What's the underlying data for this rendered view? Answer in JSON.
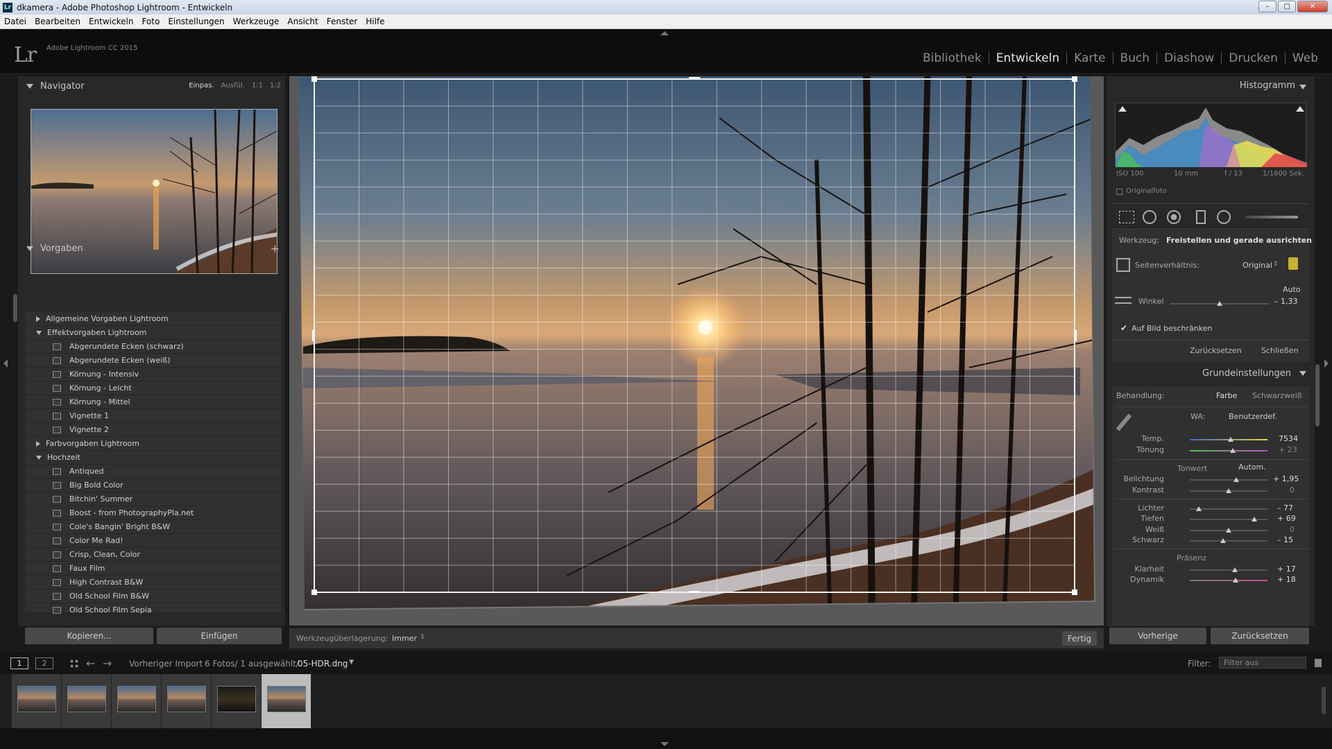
{
  "window": {
    "title": "dkamera - Adobe Photoshop Lightroom - Entwickeln",
    "controls": [
      "–",
      "□",
      "✕"
    ]
  },
  "menu": [
    "Datei",
    "Bearbeiten",
    "Entwickeln",
    "Foto",
    "Einstellungen",
    "Werkzeuge",
    "Ansicht",
    "Fenster",
    "Hilfe"
  ],
  "app": {
    "logo": "Lr",
    "version": "Adobe Lightroom CC 2015"
  },
  "modules": [
    {
      "label": "Bibliothek",
      "active": false
    },
    {
      "label": "Entwickeln",
      "active": true
    },
    {
      "label": "Karte",
      "active": false
    },
    {
      "label": "Buch",
      "active": false
    },
    {
      "label": "Diashow",
      "active": false
    },
    {
      "label": "Drucken",
      "active": false
    },
    {
      "label": "Web",
      "active": false
    }
  ],
  "navigator": {
    "title": "Navigator",
    "zoom_options": [
      "Einpas.",
      "Ausfül.",
      "1:1",
      "1:2"
    ],
    "zoom_selected": "Einpas."
  },
  "presets": {
    "title": "Vorgaben",
    "add_label": "+",
    "items": [
      {
        "label": "Allgemeine Vorgaben Lightroom",
        "type": "folder",
        "open": false
      },
      {
        "label": "Effektvorgaben Lightroom",
        "type": "folder",
        "open": true
      },
      {
        "label": "Abgerundete Ecken (schwarz)",
        "type": "preset"
      },
      {
        "label": "Abgerundete Ecken (weiß)",
        "type": "preset"
      },
      {
        "label": "Körnung - Intensiv",
        "type": "preset"
      },
      {
        "label": "Körnung - Leicht",
        "type": "preset"
      },
      {
        "label": "Körnung - Mittel",
        "type": "preset"
      },
      {
        "label": "Vignette 1",
        "type": "preset"
      },
      {
        "label": "Vignette 2",
        "type": "preset"
      },
      {
        "label": "Farbvorgaben Lightroom",
        "type": "folder",
        "open": false
      },
      {
        "label": "Hochzeit",
        "type": "folder",
        "open": true
      },
      {
        "label": "Antiqued",
        "type": "preset"
      },
      {
        "label": "Big Bold Color",
        "type": "preset"
      },
      {
        "label": "Bitchin' Summer",
        "type": "preset"
      },
      {
        "label": "Boost - from PhotographyPla.net",
        "type": "preset"
      },
      {
        "label": "Cole's Bangin' Bright B&W",
        "type": "preset"
      },
      {
        "label": "Color Me Rad!",
        "type": "preset"
      },
      {
        "label": "Crisp, Clean, Color",
        "type": "preset"
      },
      {
        "label": "Faux Film",
        "type": "preset"
      },
      {
        "label": "High Contrast B&W",
        "type": "preset"
      },
      {
        "label": "Old School Film B&W",
        "type": "preset"
      },
      {
        "label": "Old School Film Sepia",
        "type": "preset"
      }
    ]
  },
  "left_buttons": {
    "copy": "Kopieren...",
    "paste": "Einfügen"
  },
  "toolbar": {
    "overlay_label": "Werkzeugüberlagerung:",
    "overlay_value": "Immer",
    "done": "Fertig"
  },
  "histogram": {
    "title": "Histogramm",
    "iso": "ISO 100",
    "focal": "10 mm",
    "aperture": "f / 13",
    "shutter": "1/1600 Sek.",
    "original_label": "Originalfoto"
  },
  "crop": {
    "tool_label": "Werkzeug:",
    "tool_value": "Freistellen und gerade ausrichten",
    "aspect_label": "Seitenverhältnis:",
    "aspect_value": "Original",
    "auto": "Auto",
    "angle_label": "Winkel",
    "angle_value": "– 1,33",
    "angle_pos": 0.5,
    "constrain": "Auf Bild beschränken",
    "reset": "Zurücksetzen",
    "close": "Schließen"
  },
  "basic": {
    "title": "Grundeinstellungen",
    "treatment_label": "Behandlung:",
    "color": "Farbe",
    "bw": "Schwarzweiß",
    "wb_label": "WA:",
    "wb_value": "Benutzerdef.",
    "temp": {
      "label": "Temp.",
      "value": "7534",
      "pos": 0.53
    },
    "tint": {
      "label": "Tönung",
      "value": "+ 23",
      "pos": 0.55
    },
    "tone_label": "Tonwert",
    "auto": "Autom.",
    "exposure": {
      "label": "Belichtung",
      "value": "+ 1,95",
      "pos": 0.6
    },
    "contrast": {
      "label": "Kontrast",
      "value": "0",
      "pos": 0.5
    },
    "highlights": {
      "label": "Lichter",
      "value": "– 77",
      "pos": 0.12
    },
    "shadows": {
      "label": "Tiefen",
      "value": "+ 69",
      "pos": 0.83
    },
    "whites": {
      "label": "Weiß",
      "value": "0",
      "pos": 0.5
    },
    "blacks": {
      "label": "Schwarz",
      "value": "– 15",
      "pos": 0.43
    },
    "presence_label": "Präsenz",
    "clarity": {
      "label": "Klarheit",
      "value": "+ 17",
      "pos": 0.58
    },
    "vibrance": {
      "label": "Dynamik",
      "value": "+ 18",
      "pos": 0.59
    }
  },
  "right_buttons": {
    "previous": "Vorherige",
    "reset": "Zurücksetzen"
  },
  "filmbar": {
    "view1": "1",
    "view2": "2",
    "source": "Vorheriger Import",
    "count": "6 Fotos/ 1 ausgewählt/",
    "file": "05-HDR.dng",
    "filter_label": "Filter:",
    "filter_value": "Filter aus"
  },
  "filmstrip_count": 6,
  "filmstrip_selected": 5
}
